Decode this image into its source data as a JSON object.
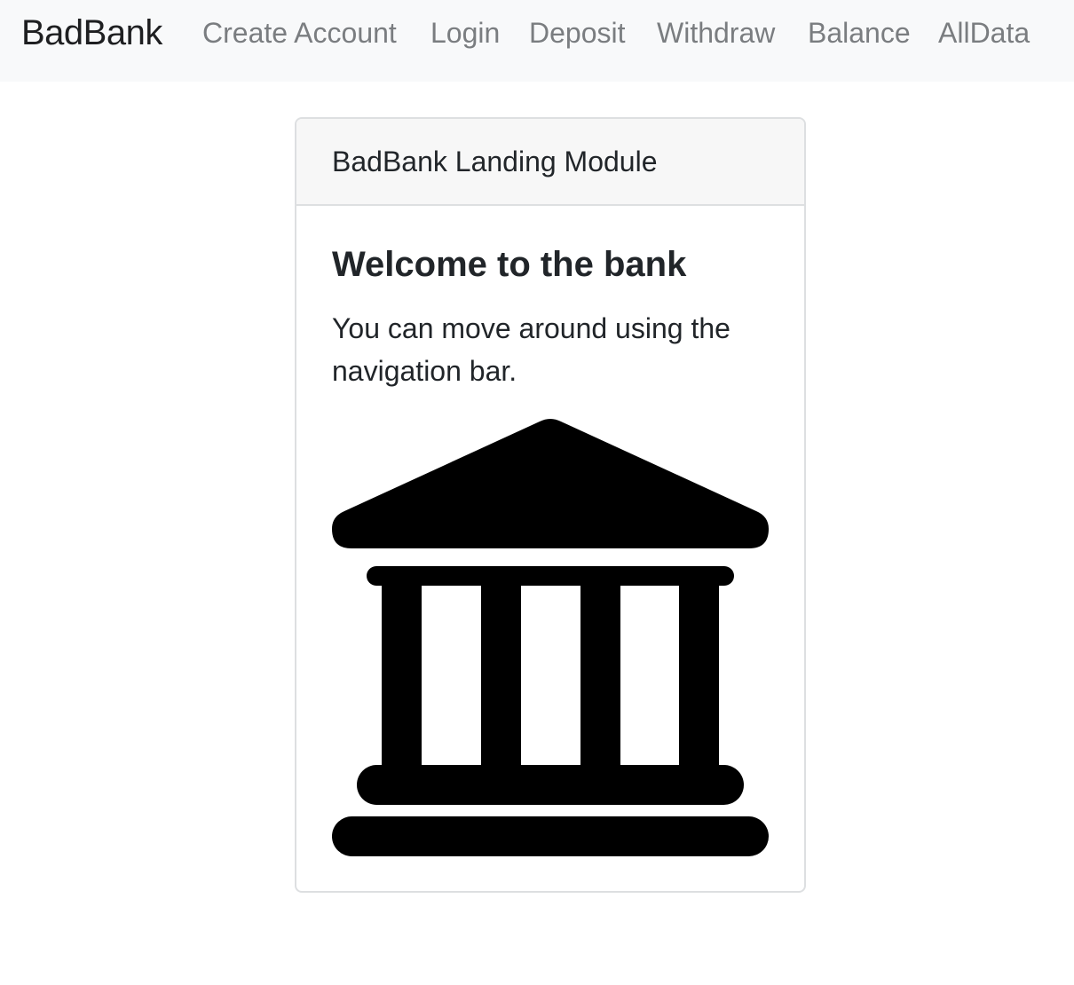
{
  "navbar": {
    "brand": "BadBank",
    "links": [
      {
        "label": "Create Account"
      },
      {
        "label": "Login"
      },
      {
        "label": "Deposit"
      },
      {
        "label": "Withdraw"
      },
      {
        "label": "Balance"
      },
      {
        "label": "AllData"
      }
    ]
  },
  "card": {
    "header": "BadBank Landing Module",
    "title": "Welcome to the bank",
    "text": "You can move around using the navigation bar.",
    "image_icon": "bank-building-icon"
  },
  "colors": {
    "navbar_bg": "#f8f9fa",
    "link_color": "#7a7d80",
    "text_color": "#212529",
    "card_border": "#dddfe1",
    "card_header_bg": "#f7f7f7"
  }
}
